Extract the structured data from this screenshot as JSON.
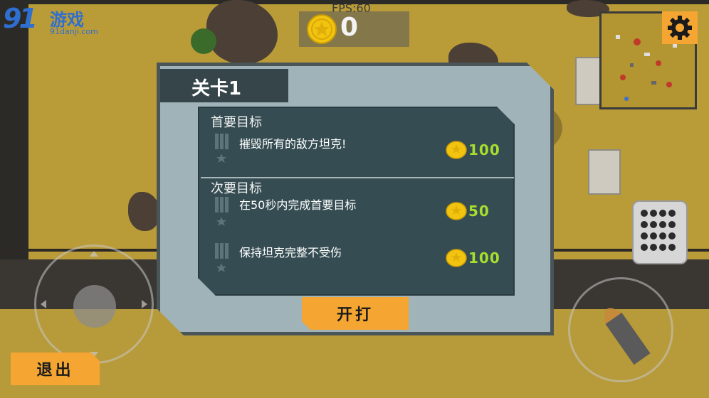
{
  "hud": {
    "fps": "FPS:60",
    "coins": "0",
    "watermark": {
      "mark": "91",
      "title": "游戏",
      "url": "91danji.com"
    }
  },
  "dialog": {
    "title": "关卡1",
    "primary": {
      "heading": "首要目标",
      "goals": [
        {
          "text": "摧毁所有的敌方坦克!",
          "reward": "100"
        }
      ]
    },
    "secondary": {
      "heading": "次要目标",
      "goals": [
        {
          "text": "在50秒内完成首要目标",
          "reward": "50"
        },
        {
          "text": "保持坦克完整不受伤",
          "reward": "100"
        }
      ]
    },
    "start_label": "开打"
  },
  "exit_label": "退出",
  "colors": {
    "accent_orange": "#f5a531",
    "panel": "#9fb3b9",
    "panel_dark": "#354d52",
    "reward_green": "#a8de2e",
    "coin_gold": "#f2c40f"
  },
  "icons": [
    "coin-icon",
    "gear-icon",
    "medal-icon",
    "star-icon",
    "bullet-icon",
    "joystick-icon"
  ]
}
